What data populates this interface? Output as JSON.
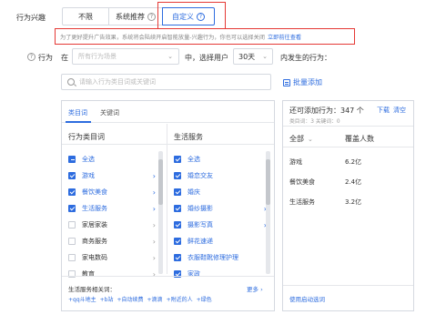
{
  "top": {
    "row_label": "行为兴趣",
    "segments": [
      "不限",
      "系统推荐",
      "自定义"
    ],
    "help_glyph": "?",
    "notice_text": "为了更好提升广告效果，系统将会陆续开启智能放量-兴趣行为，你也可以选择关闭",
    "notice_link": "立即前往查看"
  },
  "behavior": {
    "help_glyph": "?",
    "label": "行为",
    "in_label": "在",
    "app_placeholder": "所有行为场景",
    "mid_label": "中，选择用户",
    "days_value": "30天",
    "tail_label": "内发生的行为：",
    "chevron": "⌄"
  },
  "search": {
    "placeholder": "请输入行为类目词或关键词",
    "batch_label": "批量添加"
  },
  "panel": {
    "tabs": [
      "类目词",
      "关键词"
    ],
    "left_header": "行为类目词",
    "right_header": "生活服务",
    "left_items": [
      {
        "label": "全选",
        "state": "partial",
        "arrow": ""
      },
      {
        "label": "游戏",
        "state": "checked",
        "arrow": "›"
      },
      {
        "label": "餐饮美食",
        "state": "checked",
        "arrow": "›"
      },
      {
        "label": "生活服务",
        "state": "checked",
        "arrow": "›"
      },
      {
        "label": "家居家装",
        "state": "unchecked",
        "arrow": "›"
      },
      {
        "label": "商务服务",
        "state": "unchecked",
        "arrow": "›"
      },
      {
        "label": "家电数码",
        "state": "unchecked",
        "arrow": "›"
      },
      {
        "label": "教育",
        "state": "unchecked",
        "arrow": "›"
      }
    ],
    "right_items": [
      {
        "label": "全选",
        "state": "checked",
        "arrow": ""
      },
      {
        "label": "婚恋交友",
        "state": "checked",
        "arrow": ""
      },
      {
        "label": "婚庆",
        "state": "checked",
        "arrow": ""
      },
      {
        "label": "婚纱摄影",
        "state": "checked",
        "arrow": "›"
      },
      {
        "label": "摄影写真",
        "state": "checked",
        "arrow": "›"
      },
      {
        "label": "鲜花速递",
        "state": "checked",
        "arrow": ""
      },
      {
        "label": "衣服鞋靴修理护理",
        "state": "checked",
        "arrow": ""
      },
      {
        "label": "家政",
        "state": "checked",
        "arrow": ""
      }
    ],
    "footer_title": "生活服务相关词：",
    "footer_more": "更多 ›",
    "footer_tags": [
      "+qq斗地主",
      "+b站",
      "+自动续费",
      "+滴滴",
      "+附近的人",
      "+绿色"
    ]
  },
  "right_panel": {
    "title": "还可添加行为：347 个",
    "download": "下载",
    "clear": "清空",
    "subtitle": "类目词：3    关键词：0",
    "col1": "全部",
    "col2": "覆盖人数",
    "rows": [
      {
        "name": "游戏",
        "value": "6.2亿"
      },
      {
        "name": "餐饮美食",
        "value": "2.4亿"
      },
      {
        "name": "生活服务",
        "value": "3.2亿"
      }
    ],
    "footer": "使用启动选词"
  },
  "colors": {
    "accent": "#2d6cdf",
    "highlight_box": "#e53935",
    "border": "#d5d9e0"
  }
}
